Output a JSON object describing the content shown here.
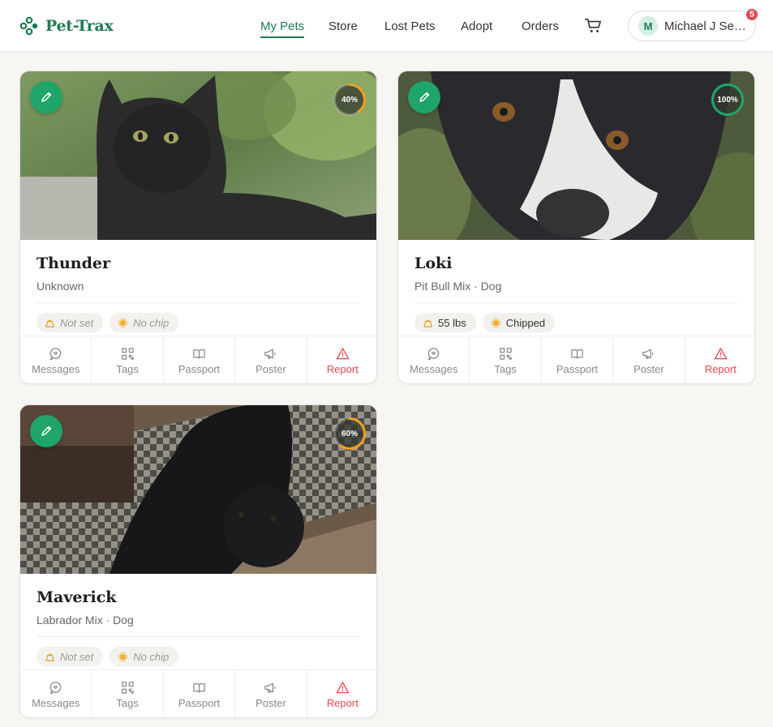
{
  "brand": {
    "name": "Pet-Trax",
    "accent": "#1f7a4f",
    "button_green": "#1fa46a",
    "danger": "#e5474c"
  },
  "nav": {
    "items": [
      {
        "label": "My Pets",
        "active": true
      },
      {
        "label": "Store",
        "active": false
      },
      {
        "label": "Lost Pets",
        "active": false
      },
      {
        "label": "Adopt",
        "active": false
      },
      {
        "label": "Orders",
        "active": false
      }
    ],
    "cart_icon": "shopping-cart-icon"
  },
  "user": {
    "initial": "M",
    "name": "Michael J Seelye",
    "name_display": "Michael J See...",
    "notification_count": "5"
  },
  "pets": [
    {
      "name": "Thunder",
      "breed": "Unknown",
      "completion": "40%",
      "completion_fraction": 0.4,
      "ring_color": "#f0a020",
      "weight": "Not set",
      "weight_set": false,
      "chip": "No chip",
      "chip_set": false
    },
    {
      "name": "Loki",
      "breed": "Pit Bull Mix · Dog",
      "completion": "100%",
      "completion_fraction": 1.0,
      "ring_color": "#1fa46a",
      "weight": "55 lbs",
      "weight_set": true,
      "chip": "Chipped",
      "chip_set": true
    },
    {
      "name": "Maverick",
      "breed": "Labrador Mix · Dog",
      "completion": "60%",
      "completion_fraction": 0.6,
      "ring_color": "#f0a020",
      "weight": "Not set",
      "weight_set": false,
      "chip": "No chip",
      "chip_set": false
    }
  ],
  "actions": {
    "messages": "Messages",
    "tags": "Tags",
    "passport": "Passport",
    "poster": "Poster",
    "report": "Report"
  }
}
